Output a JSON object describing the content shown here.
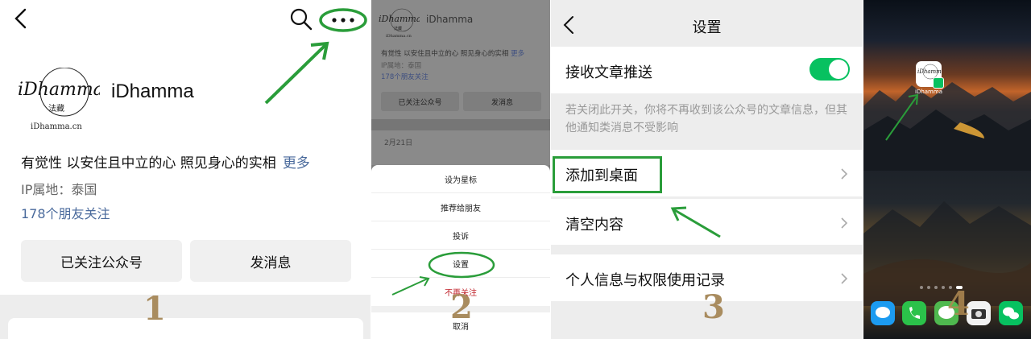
{
  "panel1": {
    "account_name": "iDhamma",
    "logo_lines": [
      "iDhamma",
      "法藏",
      "iDhamma.cn"
    ],
    "description": "有觉性 以安住且中立的心 照见身心的实相",
    "more_link": "更多",
    "ip_location": "IP属地：泰国",
    "followers": "178个朋友关注",
    "followed_button": "已关注公众号",
    "message_button": "发消息",
    "step_number": "1"
  },
  "panel2": {
    "account_name": "iDhamma",
    "description": "有觉性 以安住且中立的心 照见身心的实相",
    "more_link": "更多",
    "ip_location": "IP属地：泰国",
    "followers": "178个朋友关注",
    "followed_button": "已关注公众号",
    "message_button": "发消息",
    "date": "2月21日",
    "menu": [
      "设为星标",
      "推荐给朋友",
      "投诉",
      "设置",
      "不再关注"
    ],
    "cancel": "取消",
    "step_number": "2"
  },
  "panel3": {
    "title": "设置",
    "receive_push": "接收文章推送",
    "receive_push_on": true,
    "hint": "若关闭此开关，你将不再收到该公众号的文章信息，但其他通知类消息不受影响",
    "add_to_desktop": "添加到桌面",
    "clear_content": "清空内容",
    "privacy_record": "个人信息与权限使用记录",
    "step_number": "3"
  },
  "panel4": {
    "app_label": "iDhamma",
    "step_number": "4",
    "page_dots": 6,
    "active_dot": 5
  },
  "colors": {
    "annotation_green": "#2a9d3a",
    "wechat_green": "#07c160",
    "link_blue": "#4a6a9c",
    "warning_red": "#c0232b",
    "step_number_gold": "#a98c5f"
  }
}
